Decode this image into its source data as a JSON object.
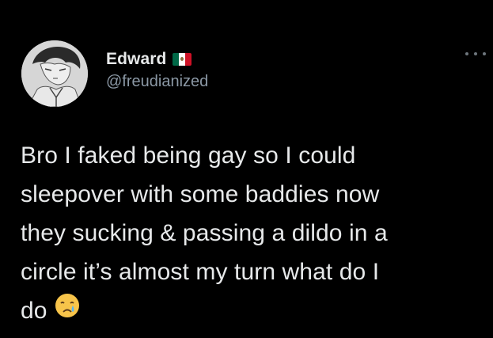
{
  "author": {
    "display_name": "Edward",
    "handle": "@freudianized",
    "flag_icon": "mexico-flag-icon",
    "flag_colors": [
      "#006847",
      "#ffffff",
      "#ce1126"
    ]
  },
  "tweet": {
    "lines": [
      "Bro I faked being gay so I could",
      "sleepover with some baddies now",
      "they sucking & passing a dildo in a",
      "circle it’s almost my turn what do I",
      "do"
    ],
    "emoji": "crying-face-emoji"
  },
  "menu": {
    "icon": "more-options-icon"
  },
  "colors": {
    "background": "#000000",
    "primary_text": "#e7e9ea",
    "secondary_text": "#8b98a5"
  }
}
